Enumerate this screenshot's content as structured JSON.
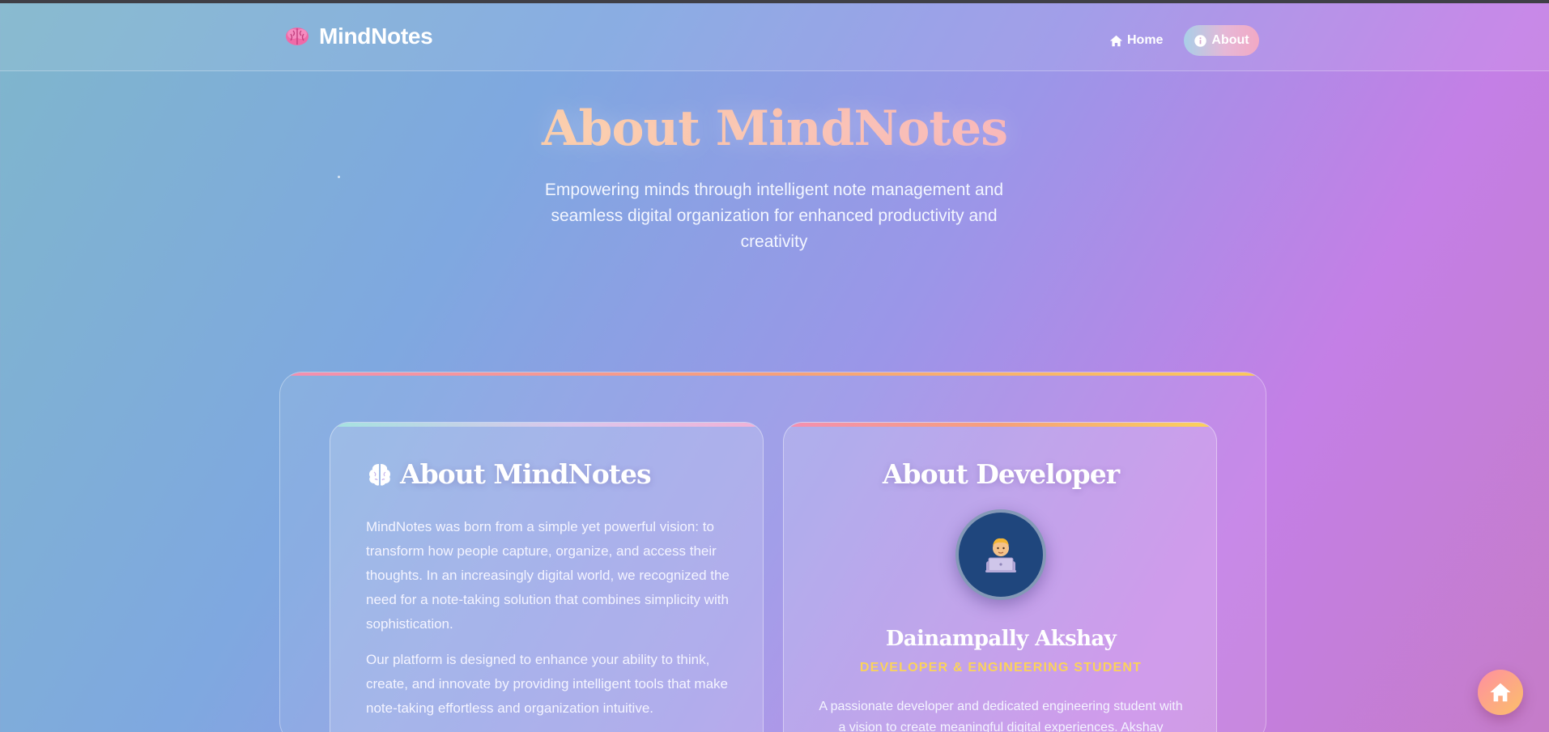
{
  "app": {
    "name": "MindNotes"
  },
  "nav": {
    "home_label": "Home",
    "about_label": "About"
  },
  "hero": {
    "title": "About MindNotes",
    "subtitle": "Empowering minds through intelligent note management and seamless digital organization for enhanced productivity and creativity"
  },
  "about_card": {
    "heading": "About MindNotes",
    "paragraphs": [
      "MindNotes was born from a simple yet powerful vision: to transform how people capture, organize, and access their thoughts. In an increasingly digital world, we recognized the need for a note-taking solution that combines simplicity with sophistication.",
      "Our platform is designed to enhance your ability to think, create, and innovate by providing intelligent tools that make note-taking effortless and organization intuitive."
    ]
  },
  "developer_card": {
    "heading": "About Developer",
    "name": "Dainampally Akshay",
    "role": "DEVELOPER & ENGINEERING STUDENT",
    "description": "A passionate developer and dedicated engineering student with a vision to create meaningful digital experiences. Akshay"
  },
  "colors": {
    "accent_yellow": "#fbd35a",
    "accent_pink": "#f48fb1",
    "accent_orange": "#f6a07a",
    "avatar_bg": "#1f467d"
  },
  "icons": {
    "brand": "brain-icon",
    "home": "home-icon",
    "about": "info-icon",
    "about_card": "brain-icon",
    "developer_avatar": "developer-emoji-icon",
    "fab": "home-icon"
  }
}
